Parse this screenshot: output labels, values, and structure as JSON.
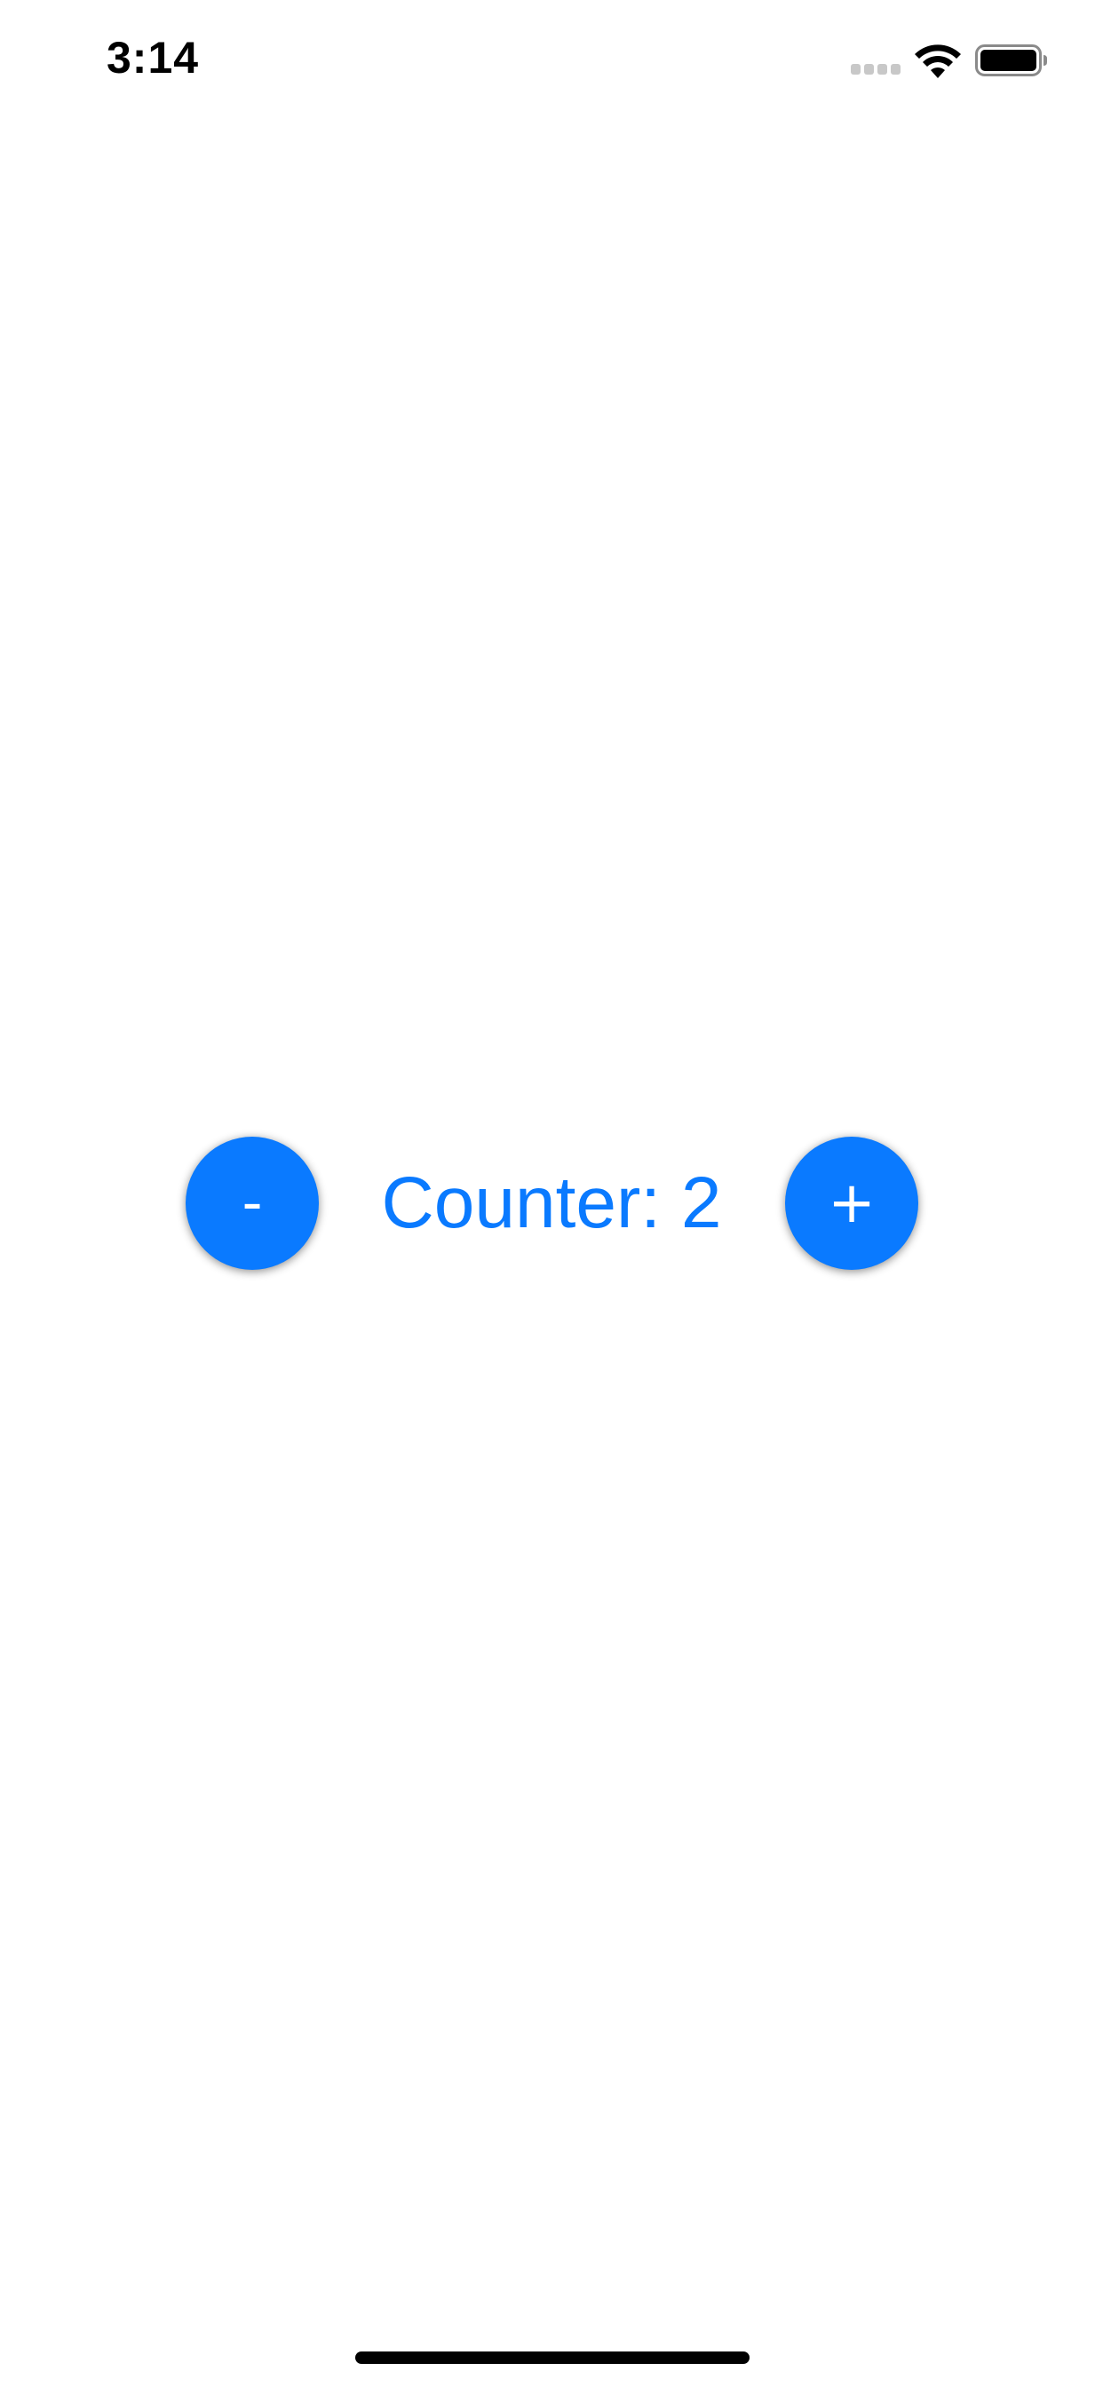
{
  "status_bar": {
    "time": "3:14",
    "icons": [
      "signal-icon",
      "wifi-icon",
      "battery-icon"
    ]
  },
  "counter": {
    "decrement_label": "-",
    "label": "Counter: 2",
    "increment_label": "+",
    "value": 2
  },
  "colors": {
    "accent": "#0a7aff",
    "background": "#ffffff",
    "text_primary": "#000000"
  }
}
